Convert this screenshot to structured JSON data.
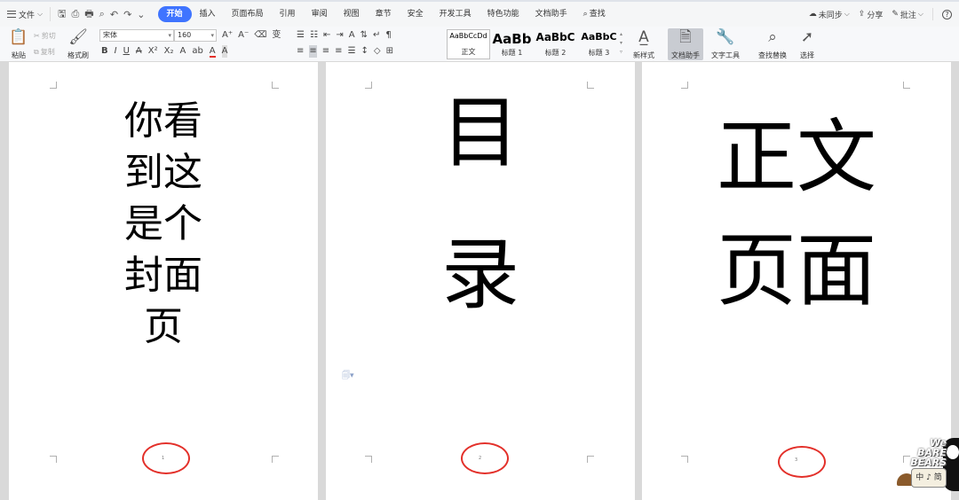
{
  "menubar": {
    "file_label": "文件",
    "tabs": [
      {
        "label": "开始",
        "active": true
      },
      {
        "label": "插入"
      },
      {
        "label": "页面布局"
      },
      {
        "label": "引用"
      },
      {
        "label": "审阅"
      },
      {
        "label": "视图"
      },
      {
        "label": "章节"
      },
      {
        "label": "安全"
      },
      {
        "label": "开发工具"
      },
      {
        "label": "特色功能"
      },
      {
        "label": "文档助手"
      }
    ],
    "search_label": "查找",
    "right": {
      "sync_label": "未同步",
      "share_label": "分享",
      "comment_label": "批注",
      "help_icon": "?"
    }
  },
  "ribbon": {
    "paste_label": "粘贴",
    "cut_label": "剪切",
    "copy_label": "复制",
    "format_painter_label": "格式刷",
    "font_name": "宋体",
    "font_size": "160",
    "styles": [
      {
        "preview": "AaBbCcDd",
        "name": "正文"
      },
      {
        "preview": "AaBb",
        "name": "标题 1"
      },
      {
        "preview": "AaBbC",
        "name": "标题 2"
      },
      {
        "preview": "AaBbC",
        "name": "标题 3"
      }
    ],
    "new_style_label": "新样式",
    "doc_assistant_label": "文档助手",
    "text_tools_label": "文字工具",
    "find_replace_label": "查找替换",
    "select_label": "选择"
  },
  "pages": [
    {
      "text": "你看\n到这\n是个\n封面\n页",
      "page_number": "1"
    },
    {
      "text": "目\n\n录",
      "page_number": "2"
    },
    {
      "text": "正文\n页面",
      "page_number": "3"
    }
  ],
  "watermark": {
    "brand": "We\nBARE\nBEARS",
    "badge": "中 ♪ 简"
  },
  "colors": {
    "accent": "#3f74ff",
    "annotation_circle": "#e3302a"
  }
}
